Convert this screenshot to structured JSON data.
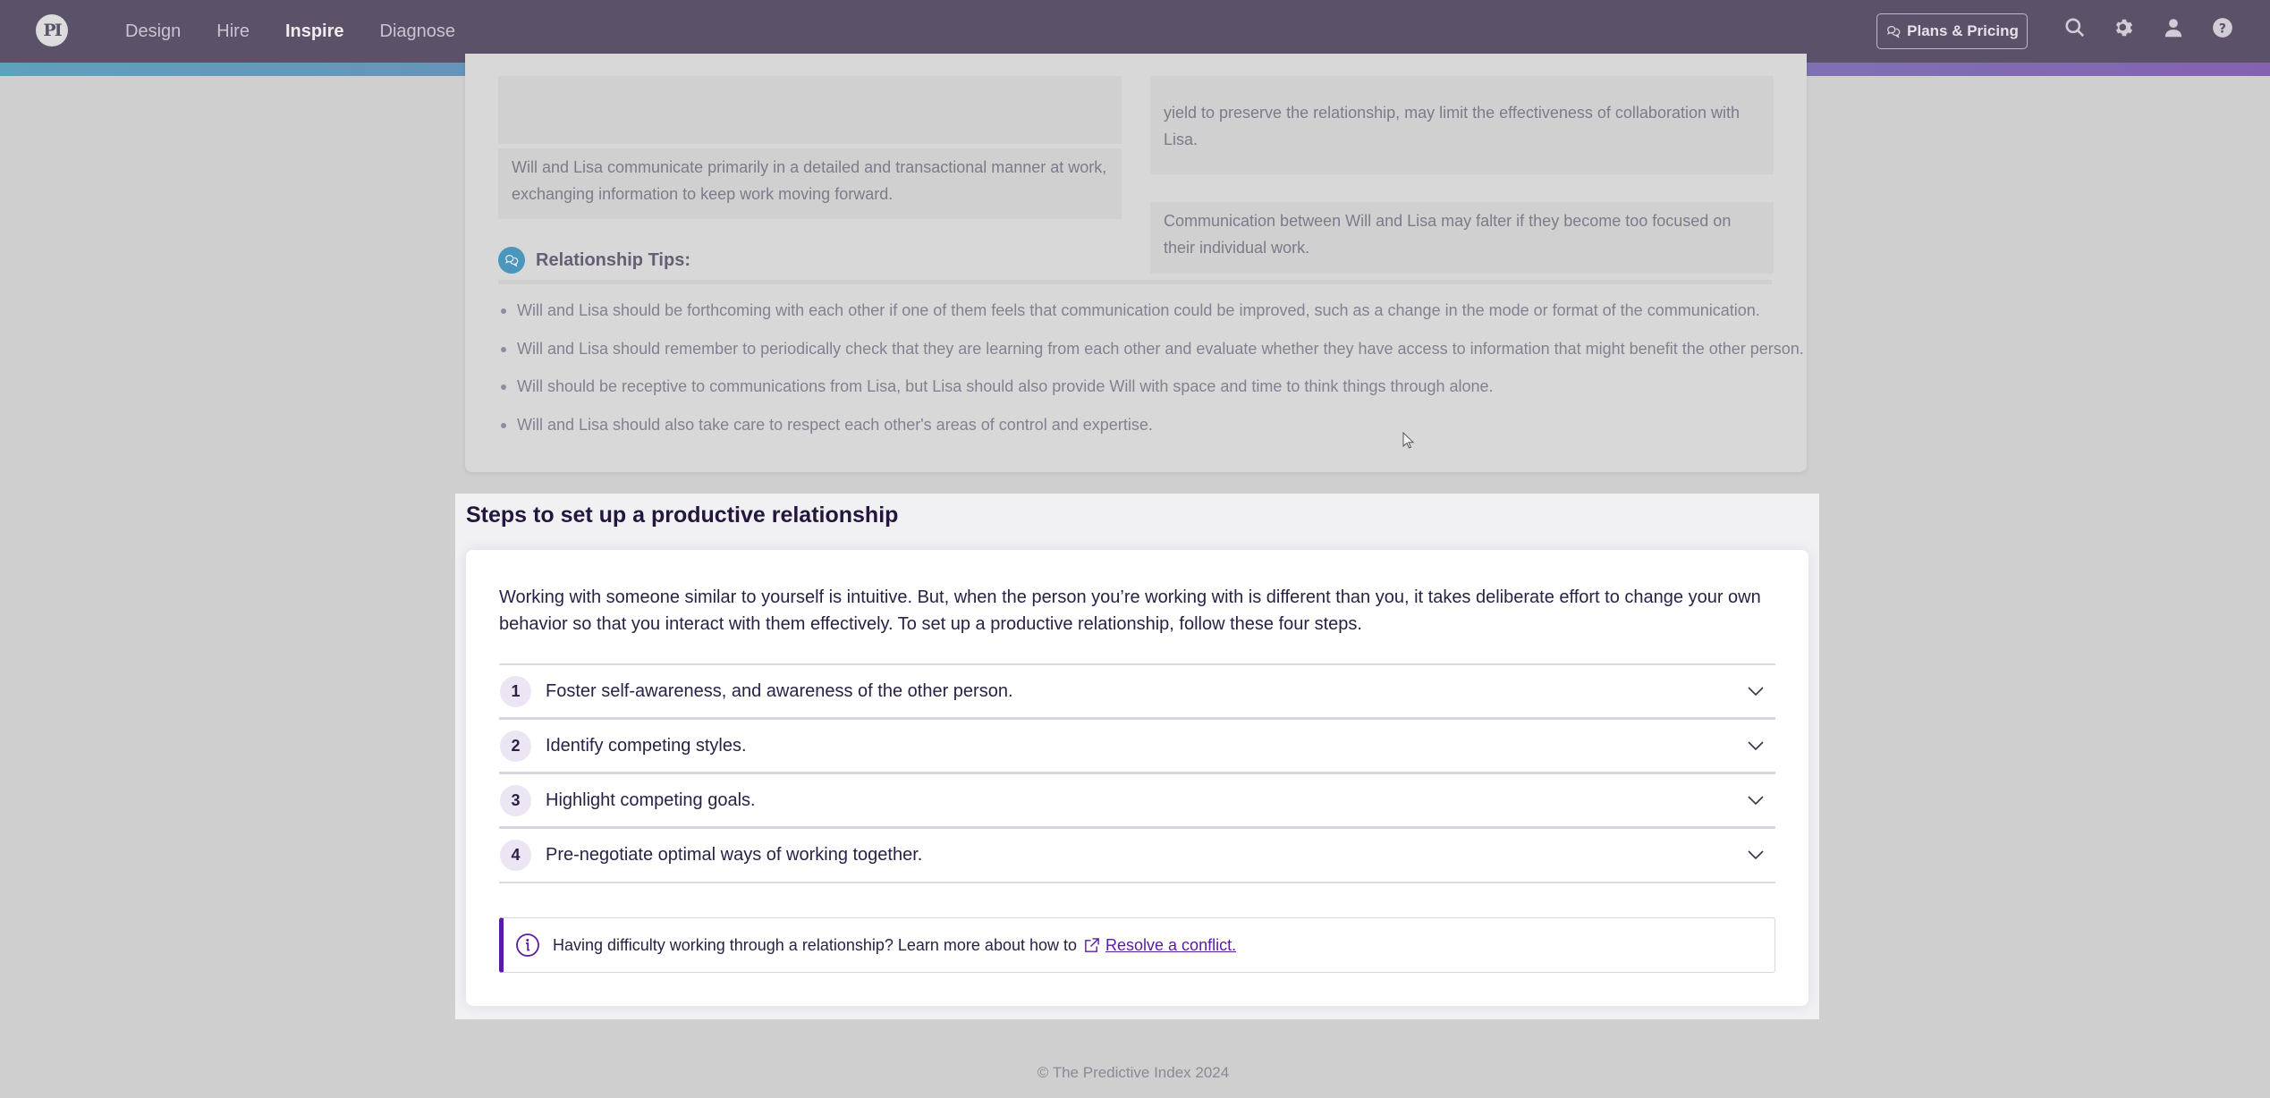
{
  "nav": {
    "logo": "PI",
    "links": [
      {
        "label": "Design",
        "active": false
      },
      {
        "label": "Hire",
        "active": false
      },
      {
        "label": "Inspire",
        "active": true
      },
      {
        "label": "Diagnose",
        "active": false
      }
    ],
    "plans_button": "Plans & Pricing",
    "icons": [
      "search-icon",
      "gear-icon",
      "user-icon",
      "help-icon"
    ]
  },
  "dimmed_card": {
    "left_box_text": "Will and Lisa communicate primarily in a detailed and transactional manner at work, exchanging information to keep work moving forward.",
    "right_box_1_text": "yield to preserve the relationship, may limit the effectiveness of collaboration with Lisa.",
    "right_box_2_text": "Communication between Will and Lisa may falter if they become too focused on their individual work.",
    "tips_title": "Relationship Tips:",
    "tips": [
      "Will and Lisa should be forthcoming with each other if one of them feels that communication could be improved, such as a change in the mode or format of the communication.",
      "Will and Lisa should remember to periodically check that they are learning from each other and evaluate whether they have access to information that might benefit the other person.",
      "Will should be receptive to communications from Lisa, but Lisa should also provide Will with space and time to think things through alone.",
      "Will and Lisa should also take care to respect each other's areas of control and expertise."
    ]
  },
  "steps": {
    "title": "Steps to set up a productive relationship",
    "intro": "Working with someone similar to yourself is intuitive. But, when the person you’re working with is different than you, it takes deliberate effort to change your own behavior so that you interact with them effectively. To set up a productive relationship, follow these four steps.",
    "items": [
      {
        "num": "1",
        "label": "Foster self-awareness, and awareness of the other person."
      },
      {
        "num": "2",
        "label": "Identify competing styles."
      },
      {
        "num": "3",
        "label": "Highlight competing goals."
      },
      {
        "num": "4",
        "label": "Pre-negotiate optimal ways of working together."
      }
    ],
    "info_text": "Having difficulty working through a relationship? Learn more about how to",
    "info_link": "Resolve a conflict."
  },
  "footer": {
    "copyright": "© The Predictive Index 2024"
  },
  "colors": {
    "nav_bg": "#5b5169",
    "accent_purple": "#5a1aa6",
    "tips_icon_blue": "#4b97bb",
    "step_badge_bg": "#ebe5f4"
  }
}
